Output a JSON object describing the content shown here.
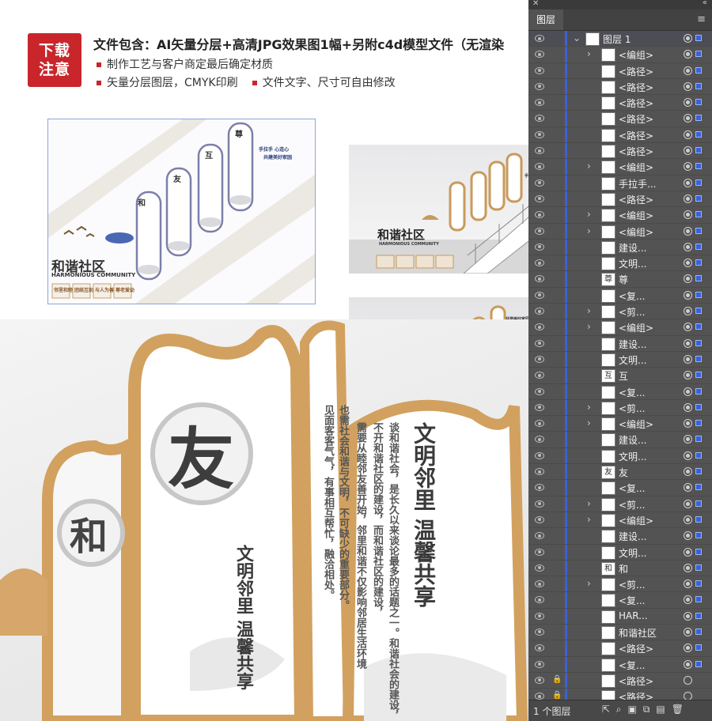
{
  "header": {
    "badge_line1": "下载",
    "badge_line2": "注意",
    "title": "文件包含：AI矢量分层+高清JPG效果图1幅+另附c4d模型文件（无渲染",
    "note1": "制作工艺与客户商定最后确定材质",
    "note2a": "矢量分层图层，CMYK印刷",
    "note2b": "文件文字、尺寸可自由修改",
    "accent_color": "#c8262b"
  },
  "preview": {
    "main_title": "和谐社区",
    "subtitle": "HARMONIOUS COMMUNITY",
    "slogan1": "手拉手 心连心",
    "slogan2": "共建美好家园",
    "panel_chars": [
      "和",
      "友",
      "互",
      "尊"
    ],
    "tiles": [
      "邻里和睦",
      "团结互助",
      "与人为善",
      "尊老爱幼"
    ],
    "closeup_char1": "和",
    "closeup_char2": "友",
    "closeup_heading": "文明邻里 温馨共享",
    "closeup_text1": "谈和谐社会，是长久以来谈论最多的话题之一。和谐社会的建设，",
    "closeup_text2": "不开和谐社区的建设，而和谐社区的建设，",
    "closeup_text3": "也需社会和谐与文明，不可缺少的重要部分。",
    "closeup_text4": "见面客客气气，有事相互帮忙，融洽相处。",
    "closeup_text5": "需要从睦邻友善开始，邻里和谐不仅影响邻居生活环境"
  },
  "layers_panel": {
    "tab": "图层",
    "close_symbol": "✕",
    "collapse_symbol": "«",
    "menu_symbol": "≡",
    "footer_count": "1 个图层",
    "rows": [
      {
        "name": "图层 1",
        "thumb": "",
        "expand": "open",
        "eye": true,
        "lock": false,
        "target": "filled",
        "top": true
      },
      {
        "name": "<编组>",
        "thumb": "",
        "expand": "closed",
        "eye": true,
        "lock": false,
        "target": "filled"
      },
      {
        "name": "<路径>",
        "thumb": "",
        "expand": "",
        "eye": true,
        "lock": false,
        "target": "filled"
      },
      {
        "name": "<路径>",
        "thumb": "",
        "expand": "",
        "eye": true,
        "lock": false,
        "target": "filled"
      },
      {
        "name": "<路径>",
        "thumb": "",
        "expand": "",
        "eye": true,
        "lock": false,
        "target": "filled"
      },
      {
        "name": "<路径>",
        "thumb": "",
        "expand": "",
        "eye": true,
        "lock": false,
        "target": "filled"
      },
      {
        "name": "<路径>",
        "thumb": "",
        "expand": "",
        "eye": true,
        "lock": false,
        "target": "filled"
      },
      {
        "name": "<路径>",
        "thumb": "",
        "expand": "",
        "eye": true,
        "lock": false,
        "target": "filled"
      },
      {
        "name": "<编组>",
        "thumb": "",
        "expand": "closed",
        "eye": true,
        "lock": false,
        "target": "filled"
      },
      {
        "name": "手拉手...",
        "thumb": "",
        "expand": "",
        "eye": true,
        "lock": false,
        "target": "filled"
      },
      {
        "name": "<路径>",
        "thumb": "",
        "expand": "",
        "eye": true,
        "lock": false,
        "target": "filled"
      },
      {
        "name": "<编组>",
        "thumb": "",
        "expand": "closed",
        "eye": true,
        "lock": false,
        "target": "filled"
      },
      {
        "name": "<编组>",
        "thumb": "",
        "expand": "closed",
        "eye": true,
        "lock": false,
        "target": "filled"
      },
      {
        "name": "建设...",
        "thumb": "",
        "expand": "",
        "eye": true,
        "lock": false,
        "target": "filled"
      },
      {
        "name": "文明...",
        "thumb": "",
        "expand": "",
        "eye": true,
        "lock": false,
        "target": "filled"
      },
      {
        "name": "尊",
        "thumb": "尊",
        "expand": "",
        "eye": true,
        "lock": false,
        "target": "filled"
      },
      {
        "name": "<复...",
        "thumb": "",
        "expand": "",
        "eye": true,
        "lock": false,
        "target": "filled"
      },
      {
        "name": "<剪...",
        "thumb": "",
        "expand": "closed",
        "eye": true,
        "lock": false,
        "target": "filled"
      },
      {
        "name": "<编组>",
        "thumb": "",
        "expand": "closed",
        "eye": true,
        "lock": false,
        "target": "filled"
      },
      {
        "name": "建设...",
        "thumb": "",
        "expand": "",
        "eye": true,
        "lock": false,
        "target": "filled"
      },
      {
        "name": "文明...",
        "thumb": "",
        "expand": "",
        "eye": true,
        "lock": false,
        "target": "filled"
      },
      {
        "name": "互",
        "thumb": "互",
        "expand": "",
        "eye": true,
        "lock": false,
        "target": "filled"
      },
      {
        "name": "<复...",
        "thumb": "",
        "expand": "",
        "eye": true,
        "lock": false,
        "target": "filled"
      },
      {
        "name": "<剪...",
        "thumb": "",
        "expand": "closed",
        "eye": true,
        "lock": false,
        "target": "filled"
      },
      {
        "name": "<编组>",
        "thumb": "",
        "expand": "closed",
        "eye": true,
        "lock": false,
        "target": "filled"
      },
      {
        "name": "建设...",
        "thumb": "",
        "expand": "",
        "eye": true,
        "lock": false,
        "target": "filled"
      },
      {
        "name": "文明...",
        "thumb": "",
        "expand": "",
        "eye": true,
        "lock": false,
        "target": "filled"
      },
      {
        "name": "友",
        "thumb": "友",
        "expand": "",
        "eye": true,
        "lock": false,
        "target": "filled"
      },
      {
        "name": "<复...",
        "thumb": "",
        "expand": "",
        "eye": true,
        "lock": false,
        "target": "filled"
      },
      {
        "name": "<剪...",
        "thumb": "",
        "expand": "closed",
        "eye": true,
        "lock": false,
        "target": "filled"
      },
      {
        "name": "<编组>",
        "thumb": "",
        "expand": "closed",
        "eye": true,
        "lock": false,
        "target": "filled"
      },
      {
        "name": "建设...",
        "thumb": "",
        "expand": "",
        "eye": true,
        "lock": false,
        "target": "filled"
      },
      {
        "name": "文明...",
        "thumb": "",
        "expand": "",
        "eye": true,
        "lock": false,
        "target": "filled"
      },
      {
        "name": "和",
        "thumb": "和",
        "expand": "",
        "eye": true,
        "lock": false,
        "target": "filled"
      },
      {
        "name": "<剪...",
        "thumb": "",
        "expand": "closed",
        "eye": true,
        "lock": false,
        "target": "filled"
      },
      {
        "name": "<复...",
        "thumb": "",
        "expand": "",
        "eye": true,
        "lock": false,
        "target": "filled"
      },
      {
        "name": "HAR...",
        "thumb": "",
        "expand": "",
        "eye": true,
        "lock": false,
        "target": "filled"
      },
      {
        "name": "和谐社区",
        "thumb": "",
        "expand": "",
        "eye": true,
        "lock": false,
        "target": "filled"
      },
      {
        "name": "<路径>",
        "thumb": "",
        "expand": "",
        "eye": true,
        "lock": false,
        "target": "filled"
      },
      {
        "name": "<复...",
        "thumb": "",
        "expand": "",
        "eye": true,
        "lock": false,
        "target": "filled"
      },
      {
        "name": "<路径>",
        "thumb": "",
        "expand": "",
        "eye": true,
        "lock": true,
        "target": "empty"
      },
      {
        "name": "<路径>",
        "thumb": "",
        "expand": "",
        "eye": true,
        "lock": true,
        "target": "empty"
      }
    ]
  }
}
